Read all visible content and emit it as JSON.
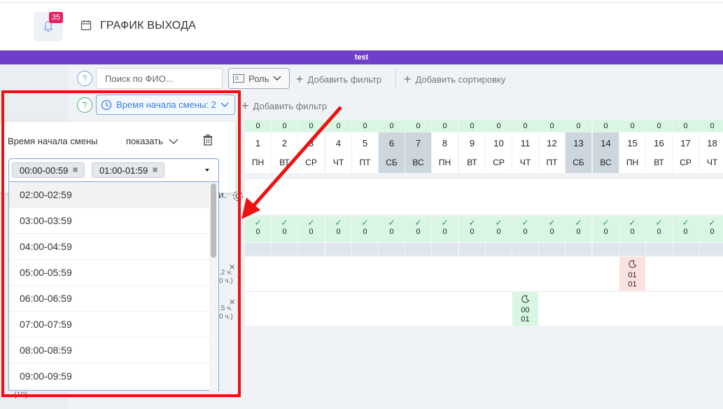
{
  "header": {
    "title": "ГРАФИК ВЫХОДА",
    "notifications": "35",
    "bell_icon": "bell-icon",
    "calendar_icon": "calendar-icon"
  },
  "banner": {
    "text": "test",
    "color": "#6f3fc9"
  },
  "toolbar": {
    "help": "?",
    "search_placeholder": "Поиск по ФИО...",
    "role_label": "Роль",
    "add_filter": "Добавить фильтр",
    "add_sort": "Добавить сортировку"
  },
  "filterbar": {
    "chip_label": "Время начала смены: 2",
    "add_filter": "Добавить фильтр"
  },
  "popup": {
    "label": "Время начала смены",
    "show": "показать",
    "tags": [
      "00:00-00:59",
      "01:00-01:59"
    ],
    "options": [
      "02:00-02:59",
      "03:00-03:59",
      "04:00-04:59",
      "05:00-05:59",
      "06:00-06:59",
      "07:00-07:59",
      "08:00-08:59",
      "09:00-09:59"
    ]
  },
  "calendar": {
    "days": [
      {
        "num": "1",
        "name": "ПН",
        "count": "0",
        "weekend": false
      },
      {
        "num": "2",
        "name": "ВТ",
        "count": "0",
        "weekend": false
      },
      {
        "num": "3",
        "name": "СР",
        "count": "0",
        "weekend": false
      },
      {
        "num": "4",
        "name": "ЧТ",
        "count": "0",
        "weekend": false
      },
      {
        "num": "5",
        "name": "ПТ",
        "count": "0",
        "weekend": false
      },
      {
        "num": "6",
        "name": "СБ",
        "count": "0",
        "weekend": true
      },
      {
        "num": "7",
        "name": "ВС",
        "count": "0",
        "weekend": true
      },
      {
        "num": "8",
        "name": "ПН",
        "count": "0",
        "weekend": false
      },
      {
        "num": "9",
        "name": "ВТ",
        "count": "0",
        "weekend": false
      },
      {
        "num": "10",
        "name": "СР",
        "count": "0",
        "weekend": false
      },
      {
        "num": "11",
        "name": "ЧТ",
        "count": "0",
        "weekend": false
      },
      {
        "num": "12",
        "name": "ПТ",
        "count": "0",
        "weekend": false
      },
      {
        "num": "13",
        "name": "СБ",
        "count": "0",
        "weekend": true
      },
      {
        "num": "14",
        "name": "ВС",
        "count": "0",
        "weekend": true
      },
      {
        "num": "15",
        "name": "ПН",
        "count": "0",
        "weekend": false
      },
      {
        "num": "16",
        "name": "ВТ",
        "count": "0",
        "weekend": false
      },
      {
        "num": "17",
        "name": "СР",
        "count": "0",
        "weekend": false
      },
      {
        "num": "18",
        "name": "ЧТ",
        "count": "0",
        "weekend": false
      }
    ],
    "ok_row_count": "0",
    "ok_mark": "✓",
    "shifts": [
      {
        "day_index": 14,
        "row": 0,
        "line1": "01",
        "line2": "01",
        "color": "#fde0e0"
      },
      {
        "day_index": 10,
        "row": 1,
        "line1": "00",
        "line2": "01",
        "color": "#d8f6e1"
      }
    ],
    "partial_rows": [
      {
        "hours": ".2 ч.",
        "sub": "0 ч.)"
      },
      {
        "hours": ".5 ч.",
        "sub": "0 ч.)"
      }
    ],
    "partial_heading": "и.",
    "bottom_text": "(19)"
  },
  "annotation": {
    "color": "#ee1111"
  }
}
